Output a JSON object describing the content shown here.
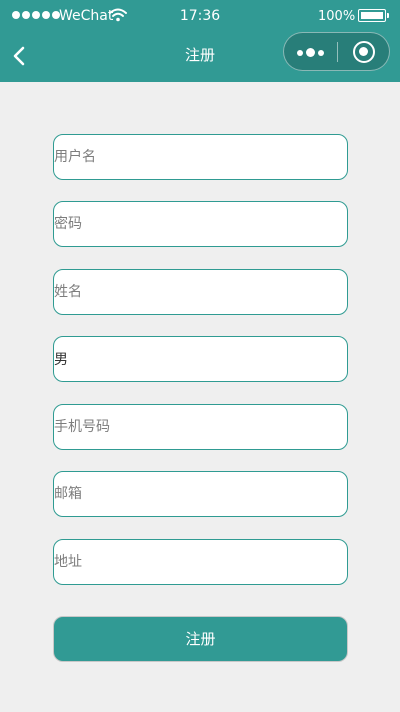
{
  "status_bar": {
    "carrier": "WeChat",
    "time": "17:36",
    "battery": "100%",
    "battery_level": 1.0
  },
  "nav": {
    "title": "注册"
  },
  "form": {
    "username_placeholder": "用户名",
    "password_placeholder": "密码",
    "name_placeholder": "姓名",
    "gender_value": "男",
    "phone_placeholder": "手机号码",
    "email_placeholder": "邮箱",
    "address_placeholder": "地址",
    "submit_label": "注册"
  },
  "colors": {
    "accent": "#319a94",
    "background": "#efefef",
    "field_border": "#2f9b92"
  },
  "icons": {
    "back": "chevron-left-icon",
    "more": "more-dots-icon",
    "close": "capsule-close-icon",
    "wifi": "wifi-icon",
    "battery": "battery-icon"
  }
}
